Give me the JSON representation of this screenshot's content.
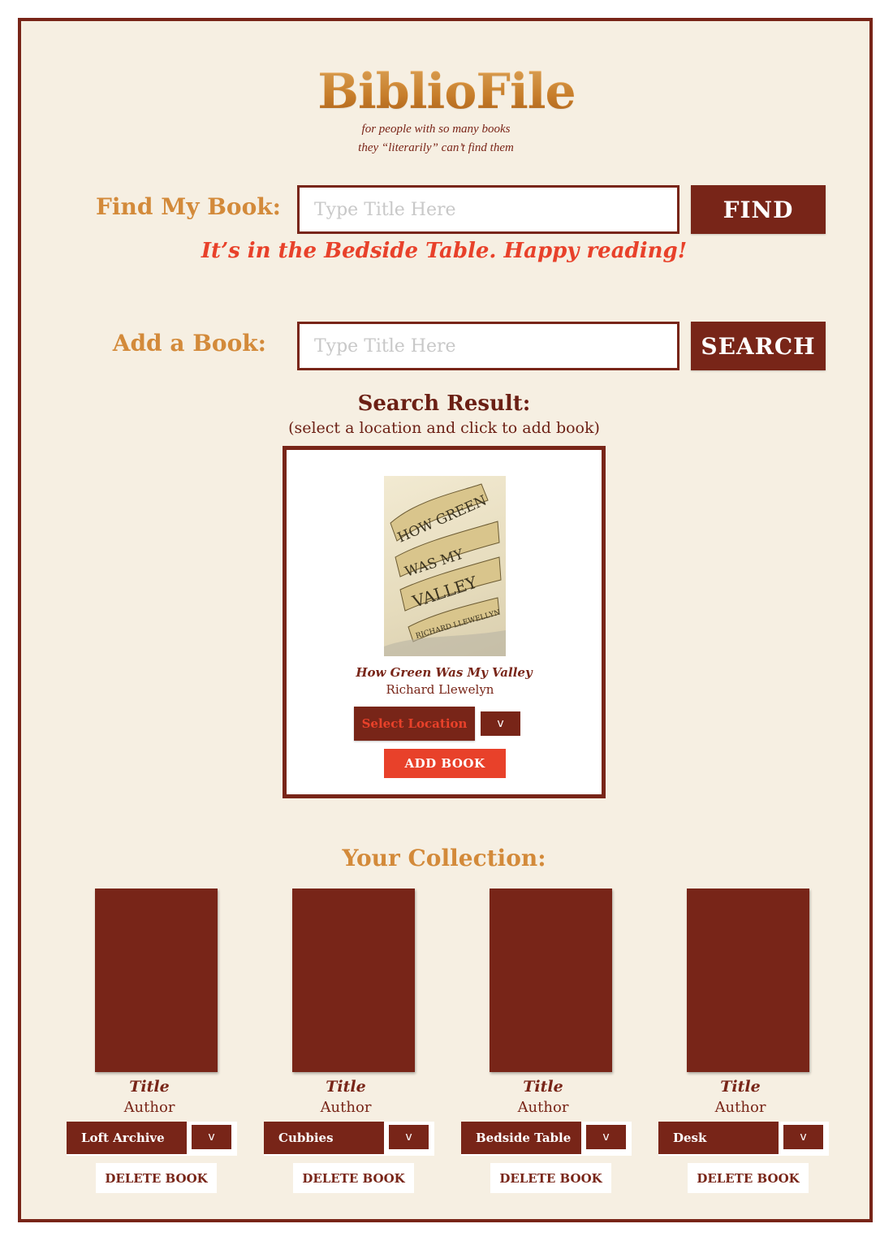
{
  "app": {
    "name": "BiblioFile",
    "tagline_line1": "for people with so many books",
    "tagline_line2": "they “literarily” can’t find them"
  },
  "find": {
    "label": "Find My Book:",
    "placeholder": "Type Title Here",
    "value": "",
    "button_label": "FIND",
    "result_message": "It’s in the Bedside Table. Happy reading!"
  },
  "add": {
    "label": "Add a Book:",
    "placeholder": "Type Title Here",
    "value": "",
    "button_label": "SEARCH"
  },
  "search_result": {
    "heading": "Search Result:",
    "subheading": "(select a location and click to add book)",
    "book": {
      "title": "How Green Was My Valley",
      "author": "Richard Llewelyn",
      "cover_text": [
        "HOW GREEN",
        "WAS MY",
        "VALLEY",
        "RICHARD LLEWELLYN"
      ]
    },
    "select_location_label": "Select Location",
    "dropdown_glyph": "v",
    "add_button_label": "ADD BOOK"
  },
  "collection": {
    "heading": "Your Collection:",
    "items": [
      {
        "title": "Title",
        "author": "Author",
        "location": "Loft Archive",
        "dropdown_glyph": "v",
        "delete_label": "DELETE BOOK"
      },
      {
        "title": "Title",
        "author": "Author",
        "location": "Cubbies",
        "dropdown_glyph": "v",
        "delete_label": "DELETE BOOK"
      },
      {
        "title": "Title",
        "author": "Author",
        "location": "Bedside Table",
        "dropdown_glyph": "v",
        "delete_label": "DELETE BOOK"
      },
      {
        "title": "Title",
        "author": "Author",
        "location": "Desk",
        "dropdown_glyph": "v",
        "delete_label": "DELETE BOOK"
      }
    ]
  },
  "colors": {
    "primary": "#782518",
    "accent": "#e8412a",
    "gold": "#d38a3a",
    "background": "#f6efe2"
  }
}
